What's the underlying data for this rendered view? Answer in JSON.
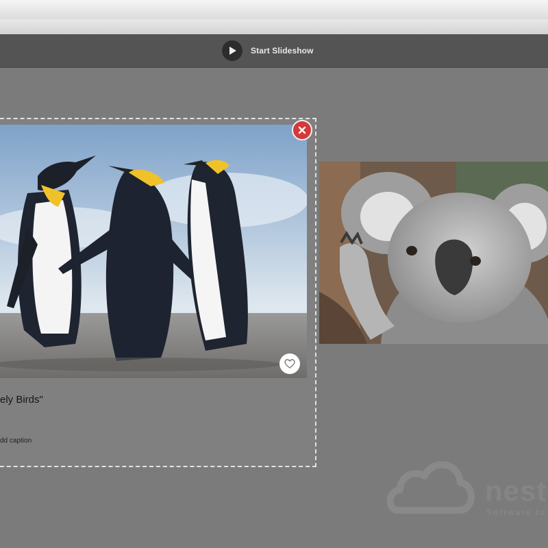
{
  "toolbar": {
    "slideshow_label": "Start Slideshow",
    "play_icon": "play-icon"
  },
  "card": {
    "title": "ely Birds\"",
    "caption": "dd caption",
    "close_icon": "close-icon",
    "favorite_icon": "heart-icon",
    "image": "penguins-photo"
  },
  "koala_card": {
    "image": "koala-photo"
  },
  "watermark": {
    "name": "nest",
    "tagline": "Software fo",
    "icon": "cloud-icon"
  },
  "colors": {
    "background": "#7b7b7b",
    "toolbar": "#545454",
    "close_red": "#d33a3a",
    "dashed_border": "#e2e2e2"
  }
}
